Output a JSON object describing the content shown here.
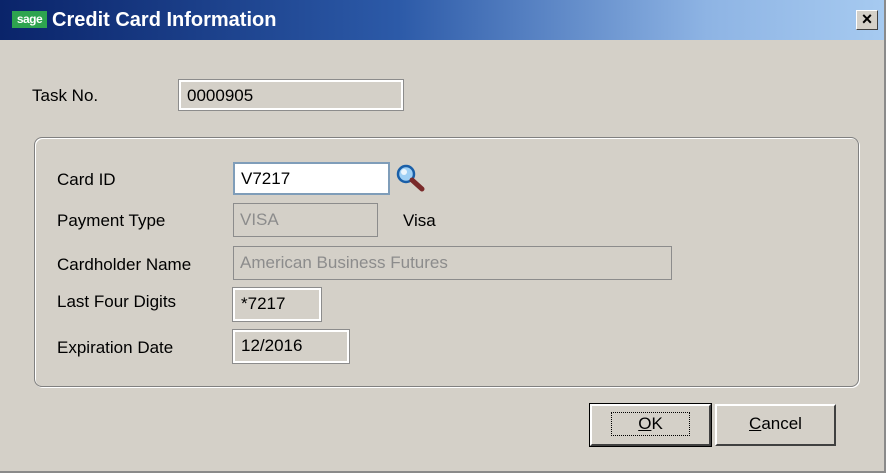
{
  "window": {
    "logo_text": "sage",
    "title": "Credit Card Information",
    "close_glyph": "×"
  },
  "task": {
    "label": "Task No.",
    "value": "0000905"
  },
  "card": {
    "card_id_label": "Card ID",
    "card_id_value": "V7217",
    "payment_type_label": "Payment Type",
    "payment_type_value": "VISA",
    "payment_type_desc": "Visa",
    "cardholder_label": "Cardholder Name",
    "cardholder_value": "American Business Futures",
    "last_four_label": "Last Four Digits",
    "last_four_value": "*7217",
    "expiration_label": "Expiration Date",
    "expiration_value": "12/2016"
  },
  "buttons": {
    "ok_label_accel": "O",
    "ok_label_rest": "K",
    "cancel_label_accel": "C",
    "cancel_label_rest": "ancel"
  },
  "icons": {
    "lookup": "magnifier-icon"
  }
}
